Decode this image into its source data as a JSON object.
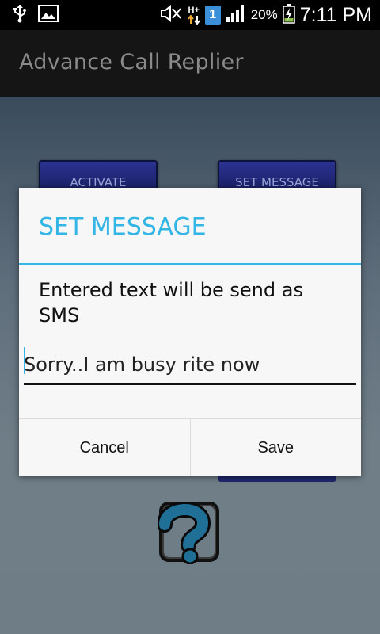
{
  "statusbar": {
    "icons_left": [
      "usb-icon",
      "image-icon"
    ],
    "icons_right": [
      "mute-icon",
      "hplus-data-icon",
      "sim-1-icon",
      "signal-icon",
      "battery-charging-icon"
    ],
    "data_label": "H+",
    "sim_label": "1",
    "battery": "20%",
    "time": "7:11 PM"
  },
  "app": {
    "title": "Advance Call Replier"
  },
  "background": {
    "activate_label": "ACTIVATE",
    "set_message_label": "SET MESSAGE",
    "help_icon": "question-mark-icon"
  },
  "dialog": {
    "title": "SET MESSAGE",
    "message": "Entered text will be send as SMS",
    "input_value": "Sorry..I am busy rite now",
    "cancel_label": "Cancel",
    "save_label": "Save",
    "accent_color": "#33b5e5"
  }
}
